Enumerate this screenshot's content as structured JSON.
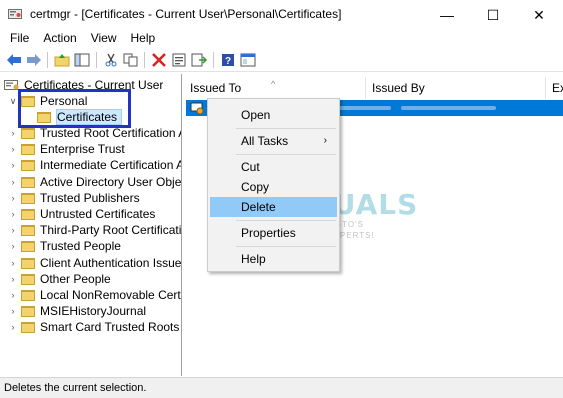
{
  "window": {
    "title": "certmgr - [Certificates - Current User\\Personal\\Certificates]",
    "minimize": "—",
    "maximize": "☐",
    "close": "✕"
  },
  "menubar": [
    "File",
    "Action",
    "View",
    "Help"
  ],
  "toolbar": {
    "icons": [
      "back-icon",
      "forward-icon",
      "up-folder-icon",
      "show-hide-tree-icon",
      "cut-icon",
      "copy-icon",
      "delete-icon",
      "properties-icon",
      "export-list-icon",
      "help-icon",
      "console-icon"
    ]
  },
  "tree": {
    "root": "Certificates - Current User",
    "personal": "Personal",
    "certificates": "Certificates",
    "items": [
      "Trusted Root Certification Au",
      "Enterprise Trust",
      "Intermediate Certification Au",
      "Active Directory User Object",
      "Trusted Publishers",
      "Untrusted Certificates",
      "Third-Party Root Certification",
      "Trusted People",
      "Client Authentication Issuers",
      "Other People",
      "Local NonRemovable Certific",
      "MSIEHistoryJournal",
      "Smart Card Trusted Roots"
    ]
  },
  "list": {
    "columns": [
      "Issued To",
      "Issued By",
      "Ex"
    ],
    "sort_indicator": "^"
  },
  "context_menu": {
    "items": [
      "Open",
      "All Tasks",
      "Cut",
      "Copy",
      "Delete",
      "Properties",
      "Help"
    ],
    "submenu_arrow": "›",
    "hovered": "Delete"
  },
  "watermark": {
    "brand": "APPUALS",
    "tagline_1": "TECH HOW-TO'S FROM",
    "tagline_2": "THE EXPERTS!"
  },
  "status": {
    "text": "Deletes the current selection."
  },
  "colors": {
    "selection": "#0078d7",
    "menu_hover": "#91c9f7",
    "highlight_box": "#2233c4",
    "folder": "#f3d36b"
  }
}
